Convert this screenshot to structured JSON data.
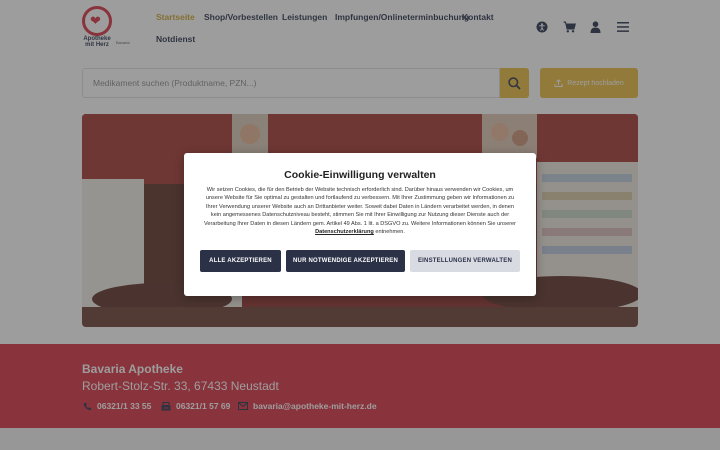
{
  "logo": {
    "line1": "Apotheke",
    "line2": "mit Herz",
    "sub": "Bavaria"
  },
  "nav": [
    {
      "label": "Startseite",
      "active": true
    },
    {
      "label": "Shop/Vorbestellen",
      "active": false
    },
    {
      "label": "Leistungen",
      "active": false
    },
    {
      "label": "Impfungen/Onlineterminbuchung",
      "active": false
    },
    {
      "label": "Kontakt",
      "active": false
    },
    {
      "label": "Notdienst",
      "active": false
    }
  ],
  "header_icons": [
    "accessibility-icon",
    "cart-icon",
    "user-icon",
    "menu-icon"
  ],
  "search": {
    "placeholder": "Medikament suchen (Produktname, PZN...)"
  },
  "upload": {
    "label": "Rezept hochladen"
  },
  "cookie": {
    "title": "Cookie-Einwilligung verwalten",
    "text": "Wir setzen Cookies, die für den Betrieb der Website technisch erforderlich sind. Darüber hinaus verwenden wir Cookies, um unsere Website für Sie optimal zu gestalten und fortlaufend zu verbessern. Mit Ihrer Zustimmung geben wir Informationen zu Ihrer Verwendung unserer Website auch an Drittanbieter weiter. Soweit dabei Daten in Ländern verarbeitet werden, in denen kein angemessenes Datenschutzniveau besteht, stimmen Sie mit Ihrer Einwilligung zur Nutzung dieser Dienste auch der Verarbeitung Ihrer Daten in diesen Ländern gem. Artikel 49 Abs. 1 lit. a DSGVO zu. Weitere Informationen können Sie unserer",
    "link": "Datenschutzerklärung",
    "suffix": " entnehmen.",
    "btn_accept_all": "ALLE AKZEPTIEREN",
    "btn_necessary": "NUR NOTWENDIGE AKZEPTIEREN",
    "btn_settings": "EINSTELLUNGEN VERWALTEN"
  },
  "pharmacy": {
    "name": "Bavaria Apotheke",
    "address": "Robert-Stolz-Str. 33, 67433 Neustadt",
    "phone": "06321/1 33 55",
    "fax": "06321/1 57 69",
    "email": "bavaria@apotheke-mit-herz.de"
  },
  "colors": {
    "accent": "#e8b93a",
    "brand_red": "#d72a3c",
    "navy": "#2b3147"
  }
}
